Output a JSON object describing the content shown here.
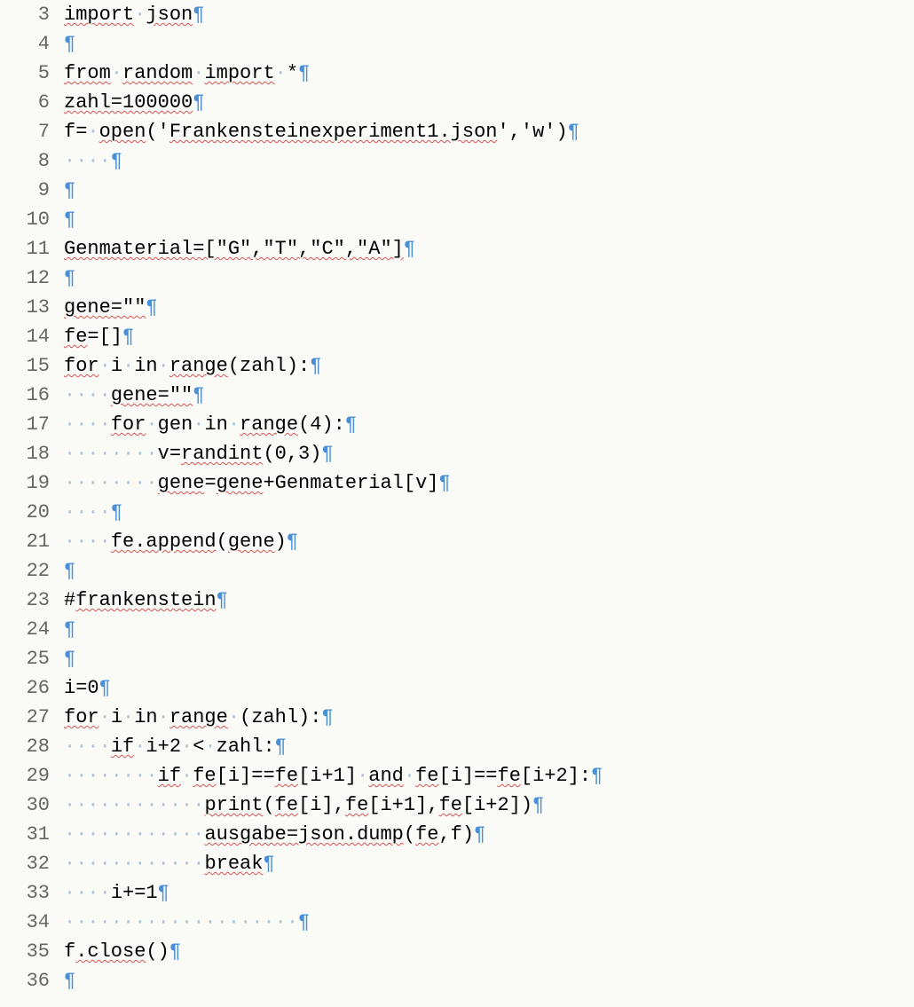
{
  "editor": {
    "lines": [
      {
        "num": 3,
        "segs": [
          {
            "t": "import",
            "sq": true
          },
          {
            "t": " ",
            "dot": true
          },
          {
            "t": "json",
            "sq": true
          }
        ]
      },
      {
        "num": 4,
        "segs": []
      },
      {
        "num": 5,
        "segs": [
          {
            "t": "from",
            "sq": true
          },
          {
            "t": " ",
            "dot": true
          },
          {
            "t": "random",
            "sq": true
          },
          {
            "t": " ",
            "dot": true
          },
          {
            "t": "import",
            "sq": true
          },
          {
            "t": " ",
            "dot": true
          },
          {
            "t": "*"
          }
        ]
      },
      {
        "num": 6,
        "segs": [
          {
            "t": "zahl=100000",
            "sq": true
          }
        ]
      },
      {
        "num": 7,
        "segs": [
          {
            "t": "f="
          },
          {
            "t": " ",
            "dot": true
          },
          {
            "t": "open",
            "sq": true
          },
          {
            "t": "('"
          },
          {
            "t": "Frankensteinexperiment1.json",
            "sq": true
          },
          {
            "t": "','w')"
          }
        ]
      },
      {
        "num": 8,
        "segs": [
          {
            "t": "    ",
            "dot": true
          }
        ]
      },
      {
        "num": 9,
        "segs": []
      },
      {
        "num": 10,
        "segs": []
      },
      {
        "num": 11,
        "segs": [
          {
            "t": "Genmaterial=[\"G\",\"T\",\"C\",\"A\"]",
            "sq": true
          }
        ]
      },
      {
        "num": 12,
        "segs": []
      },
      {
        "num": 13,
        "segs": [
          {
            "t": "gene=\"\"",
            "sq": true
          }
        ]
      },
      {
        "num": 14,
        "segs": [
          {
            "t": "fe",
            "sq": true
          },
          {
            "t": "=[]"
          }
        ]
      },
      {
        "num": 15,
        "segs": [
          {
            "t": "for",
            "sq": true
          },
          {
            "t": " ",
            "dot": true
          },
          {
            "t": "i"
          },
          {
            "t": " ",
            "dot": true
          },
          {
            "t": "in"
          },
          {
            "t": " ",
            "dot": true
          },
          {
            "t": "range",
            "sq": true
          },
          {
            "t": "(zahl):"
          }
        ]
      },
      {
        "num": 16,
        "segs": [
          {
            "t": "    ",
            "dot": true
          },
          {
            "t": "gene=\"\"",
            "sq": true
          }
        ]
      },
      {
        "num": 17,
        "segs": [
          {
            "t": "    ",
            "dot": true
          },
          {
            "t": "for",
            "sq": true
          },
          {
            "t": " ",
            "dot": true
          },
          {
            "t": "gen"
          },
          {
            "t": " ",
            "dot": true
          },
          {
            "t": "in"
          },
          {
            "t": " ",
            "dot": true
          },
          {
            "t": "range",
            "sq": true
          },
          {
            "t": "(4):"
          }
        ]
      },
      {
        "num": 18,
        "segs": [
          {
            "t": "        ",
            "dot": true
          },
          {
            "t": "v="
          },
          {
            "t": "randint",
            "sq": true
          },
          {
            "t": "(0,3)"
          }
        ]
      },
      {
        "num": 19,
        "segs": [
          {
            "t": "        ",
            "dot": true
          },
          {
            "t": "gene",
            "sq": true
          },
          {
            "t": "="
          },
          {
            "t": "gene",
            "sq": true
          },
          {
            "t": "+Genmaterial[v]"
          }
        ]
      },
      {
        "num": 20,
        "segs": [
          {
            "t": "    ",
            "dot": true
          }
        ]
      },
      {
        "num": 21,
        "segs": [
          {
            "t": "    ",
            "dot": true
          },
          {
            "t": "fe.append",
            "sq": true
          },
          {
            "t": "("
          },
          {
            "t": "gene",
            "sq": true
          },
          {
            "t": ")"
          }
        ]
      },
      {
        "num": 22,
        "segs": []
      },
      {
        "num": 23,
        "segs": [
          {
            "t": "#"
          },
          {
            "t": "frankenstein",
            "sq": true
          }
        ]
      },
      {
        "num": 24,
        "segs": []
      },
      {
        "num": 25,
        "segs": []
      },
      {
        "num": 26,
        "segs": [
          {
            "t": "i=0"
          }
        ]
      },
      {
        "num": 27,
        "segs": [
          {
            "t": "for",
            "sq": true
          },
          {
            "t": " ",
            "dot": true
          },
          {
            "t": "i"
          },
          {
            "t": " ",
            "dot": true
          },
          {
            "t": "in"
          },
          {
            "t": " ",
            "dot": true
          },
          {
            "t": "range",
            "sq": true
          },
          {
            "t": " ",
            "dot": true
          },
          {
            "t": "(zahl):"
          }
        ]
      },
      {
        "num": 28,
        "segs": [
          {
            "t": "    ",
            "dot": true
          },
          {
            "t": "if",
            "sq": true
          },
          {
            "t": " ",
            "dot": true
          },
          {
            "t": "i+2"
          },
          {
            "t": " ",
            "dot": true
          },
          {
            "t": "<"
          },
          {
            "t": " ",
            "dot": true
          },
          {
            "t": "zahl:"
          }
        ]
      },
      {
        "num": 29,
        "segs": [
          {
            "t": "        ",
            "dot": true
          },
          {
            "t": "if",
            "sq": true
          },
          {
            "t": " ",
            "dot": true
          },
          {
            "t": "fe",
            "sq": true
          },
          {
            "t": "[i]=="
          },
          {
            "t": "fe",
            "sq": true
          },
          {
            "t": "[i+1]"
          },
          {
            "t": " ",
            "dot": true
          },
          {
            "t": "and",
            "sq": true
          },
          {
            "t": " ",
            "dot": true
          },
          {
            "t": "fe",
            "sq": true
          },
          {
            "t": "[i]=="
          },
          {
            "t": "fe",
            "sq": true
          },
          {
            "t": "[i+2]:"
          }
        ]
      },
      {
        "num": 30,
        "segs": [
          {
            "t": "            ",
            "dot": true
          },
          {
            "t": "print",
            "sq": true
          },
          {
            "t": "("
          },
          {
            "t": "fe",
            "sq": true
          },
          {
            "t": "[i],"
          },
          {
            "t": "fe",
            "sq": true
          },
          {
            "t": "[i+1],"
          },
          {
            "t": "fe",
            "sq": true
          },
          {
            "t": "[i+2])"
          }
        ]
      },
      {
        "num": 31,
        "segs": [
          {
            "t": "            ",
            "dot": true
          },
          {
            "t": "ausgabe=json.dump",
            "sq": true
          },
          {
            "t": "("
          },
          {
            "t": "fe",
            "sq": true
          },
          {
            "t": ",f)"
          }
        ]
      },
      {
        "num": 32,
        "segs": [
          {
            "t": "            ",
            "dot": true
          },
          {
            "t": "break",
            "sq": true
          }
        ]
      },
      {
        "num": 33,
        "segs": [
          {
            "t": "    ",
            "dot": true
          },
          {
            "t": "i+=1"
          }
        ]
      },
      {
        "num": 34,
        "segs": [
          {
            "t": "                    ",
            "dot": true
          }
        ]
      },
      {
        "num": 35,
        "segs": [
          {
            "t": "f"
          },
          {
            "t": ".close",
            "sq": true
          },
          {
            "t": "()"
          }
        ]
      },
      {
        "num": 36,
        "segs": []
      }
    ],
    "pilcrow": "¶",
    "space_dot": "·"
  }
}
